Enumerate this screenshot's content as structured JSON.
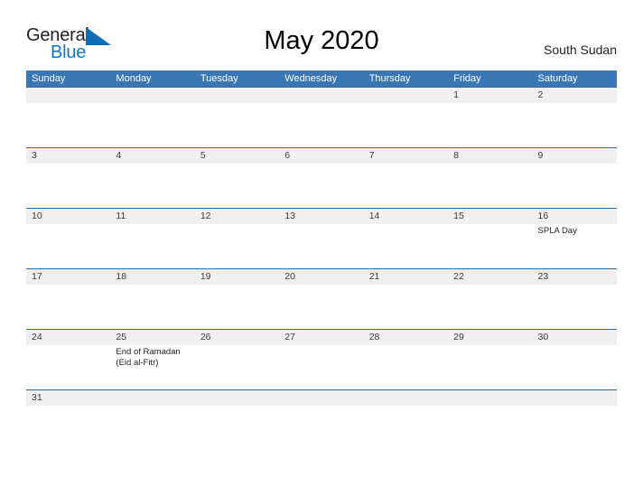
{
  "brand": {
    "name_part1": "General",
    "name_part2": "Blue",
    "flag_icon": "flag-triangle-icon",
    "blue": "#1277bc"
  },
  "header": {
    "title": "May 2020",
    "country": "South Sudan"
  },
  "theme": {
    "header_blue": "#3a75b4",
    "rule_blue": "#2e6da4",
    "band_gray": "#f0f0f0",
    "text_dark": "#231f20"
  },
  "weekdays": [
    "Sunday",
    "Monday",
    "Tuesday",
    "Wednesday",
    "Thursday",
    "Friday",
    "Saturday"
  ],
  "weeks": [
    {
      "days": [
        {
          "num": "",
          "events": []
        },
        {
          "num": "",
          "events": []
        },
        {
          "num": "",
          "events": []
        },
        {
          "num": "",
          "events": []
        },
        {
          "num": "",
          "events": []
        },
        {
          "num": "1",
          "events": []
        },
        {
          "num": "2",
          "events": []
        }
      ]
    },
    {
      "days": [
        {
          "num": "3",
          "events": []
        },
        {
          "num": "4",
          "events": []
        },
        {
          "num": "5",
          "events": []
        },
        {
          "num": "6",
          "events": []
        },
        {
          "num": "7",
          "events": []
        },
        {
          "num": "8",
          "events": []
        },
        {
          "num": "9",
          "events": []
        }
      ]
    },
    {
      "days": [
        {
          "num": "10",
          "events": []
        },
        {
          "num": "11",
          "events": []
        },
        {
          "num": "12",
          "events": []
        },
        {
          "num": "13",
          "events": []
        },
        {
          "num": "14",
          "events": []
        },
        {
          "num": "15",
          "events": []
        },
        {
          "num": "16",
          "events": [
            "SPLA Day"
          ]
        }
      ]
    },
    {
      "days": [
        {
          "num": "17",
          "events": []
        },
        {
          "num": "18",
          "events": []
        },
        {
          "num": "19",
          "events": []
        },
        {
          "num": "20",
          "events": []
        },
        {
          "num": "21",
          "events": []
        },
        {
          "num": "22",
          "events": []
        },
        {
          "num": "23",
          "events": []
        }
      ]
    },
    {
      "days": [
        {
          "num": "24",
          "events": []
        },
        {
          "num": "25",
          "events": [
            "End of Ramadan",
            "(Eid al-Fitr)"
          ]
        },
        {
          "num": "26",
          "events": []
        },
        {
          "num": "27",
          "events": []
        },
        {
          "num": "28",
          "events": []
        },
        {
          "num": "29",
          "events": []
        },
        {
          "num": "30",
          "events": []
        }
      ]
    },
    {
      "days": [
        {
          "num": "31",
          "events": []
        },
        {
          "num": "",
          "events": []
        },
        {
          "num": "",
          "events": []
        },
        {
          "num": "",
          "events": []
        },
        {
          "num": "",
          "events": []
        },
        {
          "num": "",
          "events": []
        },
        {
          "num": "",
          "events": []
        }
      ]
    }
  ]
}
